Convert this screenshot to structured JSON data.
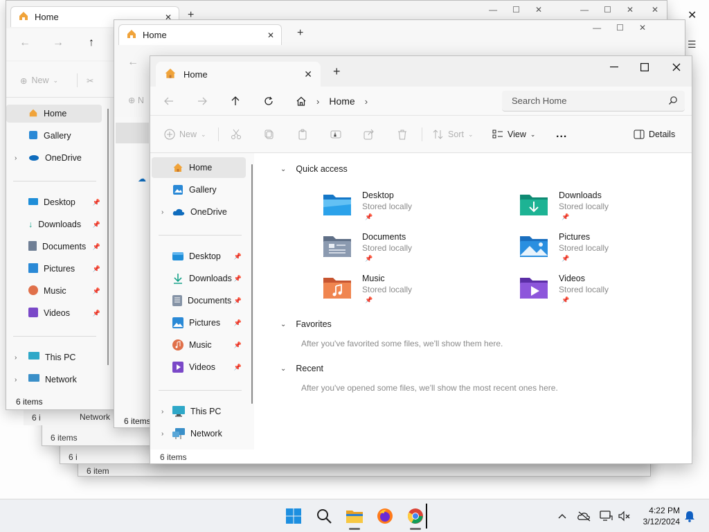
{
  "ghost_windows": {
    "back_tab_title": "Home",
    "middle_tab_title": "Home",
    "back_sidebar": {
      "items": [
        {
          "label": "Home"
        },
        {
          "label": "Gallery"
        },
        {
          "label": "OneDrive"
        },
        {
          "label": "Desktop"
        },
        {
          "label": "Downloads"
        },
        {
          "label": "Documents"
        },
        {
          "label": "Pictures"
        },
        {
          "label": "Music"
        },
        {
          "label": "Videos"
        },
        {
          "label": "This PC"
        },
        {
          "label": "Network"
        }
      ],
      "new_label": "New",
      "item_count": "6 items"
    },
    "middle_item_count": "6 items",
    "stack_item_counts": [
      "6 items",
      "6 i",
      "6 i",
      "6 item",
      "6 items"
    ],
    "stack_network_label": "Network"
  },
  "window": {
    "tab_title": "Home",
    "search_placeholder": "Search Home",
    "breadcrumb": {
      "root_label": "Home"
    },
    "commands": {
      "new_label": "New",
      "sort_label": "Sort",
      "view_label": "View",
      "more_label": "...",
      "details_label": "Details"
    },
    "sidebar": {
      "items": [
        {
          "label": "Home",
          "icon": "home-icon"
        },
        {
          "label": "Gallery",
          "icon": "gallery-icon"
        },
        {
          "label": "OneDrive",
          "icon": "onedrive-icon"
        },
        {
          "label": "Desktop",
          "icon": "desktop-folder-icon"
        },
        {
          "label": "Downloads",
          "icon": "downloads-folder-icon"
        },
        {
          "label": "Documents",
          "icon": "documents-folder-icon"
        },
        {
          "label": "Pictures",
          "icon": "pictures-folder-icon"
        },
        {
          "label": "Music",
          "icon": "music-folder-icon"
        },
        {
          "label": "Videos",
          "icon": "videos-folder-icon"
        },
        {
          "label": "This PC",
          "icon": "this-pc-icon"
        },
        {
          "label": "Network",
          "icon": "network-icon"
        }
      ]
    },
    "quick_access": {
      "heading": "Quick access",
      "items": [
        {
          "name": "Desktop",
          "subtitle": "Stored locally",
          "color": "#1f8ed8"
        },
        {
          "name": "Downloads",
          "subtitle": "Stored locally",
          "color": "#18a38a"
        },
        {
          "name": "Documents",
          "subtitle": "Stored locally",
          "color": "#6f7f95"
        },
        {
          "name": "Pictures",
          "subtitle": "Stored locally",
          "color": "#2a89d6"
        },
        {
          "name": "Music",
          "subtitle": "Stored locally",
          "color": "#e0704a"
        },
        {
          "name": "Videos",
          "subtitle": "Stored locally",
          "color": "#7a48c8"
        }
      ]
    },
    "favorites": {
      "heading": "Favorites",
      "hint": "After you've favorited some files, we'll show them here."
    },
    "recent": {
      "heading": "Recent",
      "hint": "After you've opened some files, we'll show the most recent ones here."
    },
    "status_text": "6 items"
  },
  "taskbar": {
    "apps": [
      "start-icon",
      "search-icon",
      "file-explorer-icon",
      "firefox-icon",
      "chrome-icon"
    ],
    "clock_time": "4:22 PM",
    "clock_date": "3/12/2024"
  },
  "colors": {
    "folder_orange": "#f0a33a",
    "accent_blue": "#0067c0"
  }
}
